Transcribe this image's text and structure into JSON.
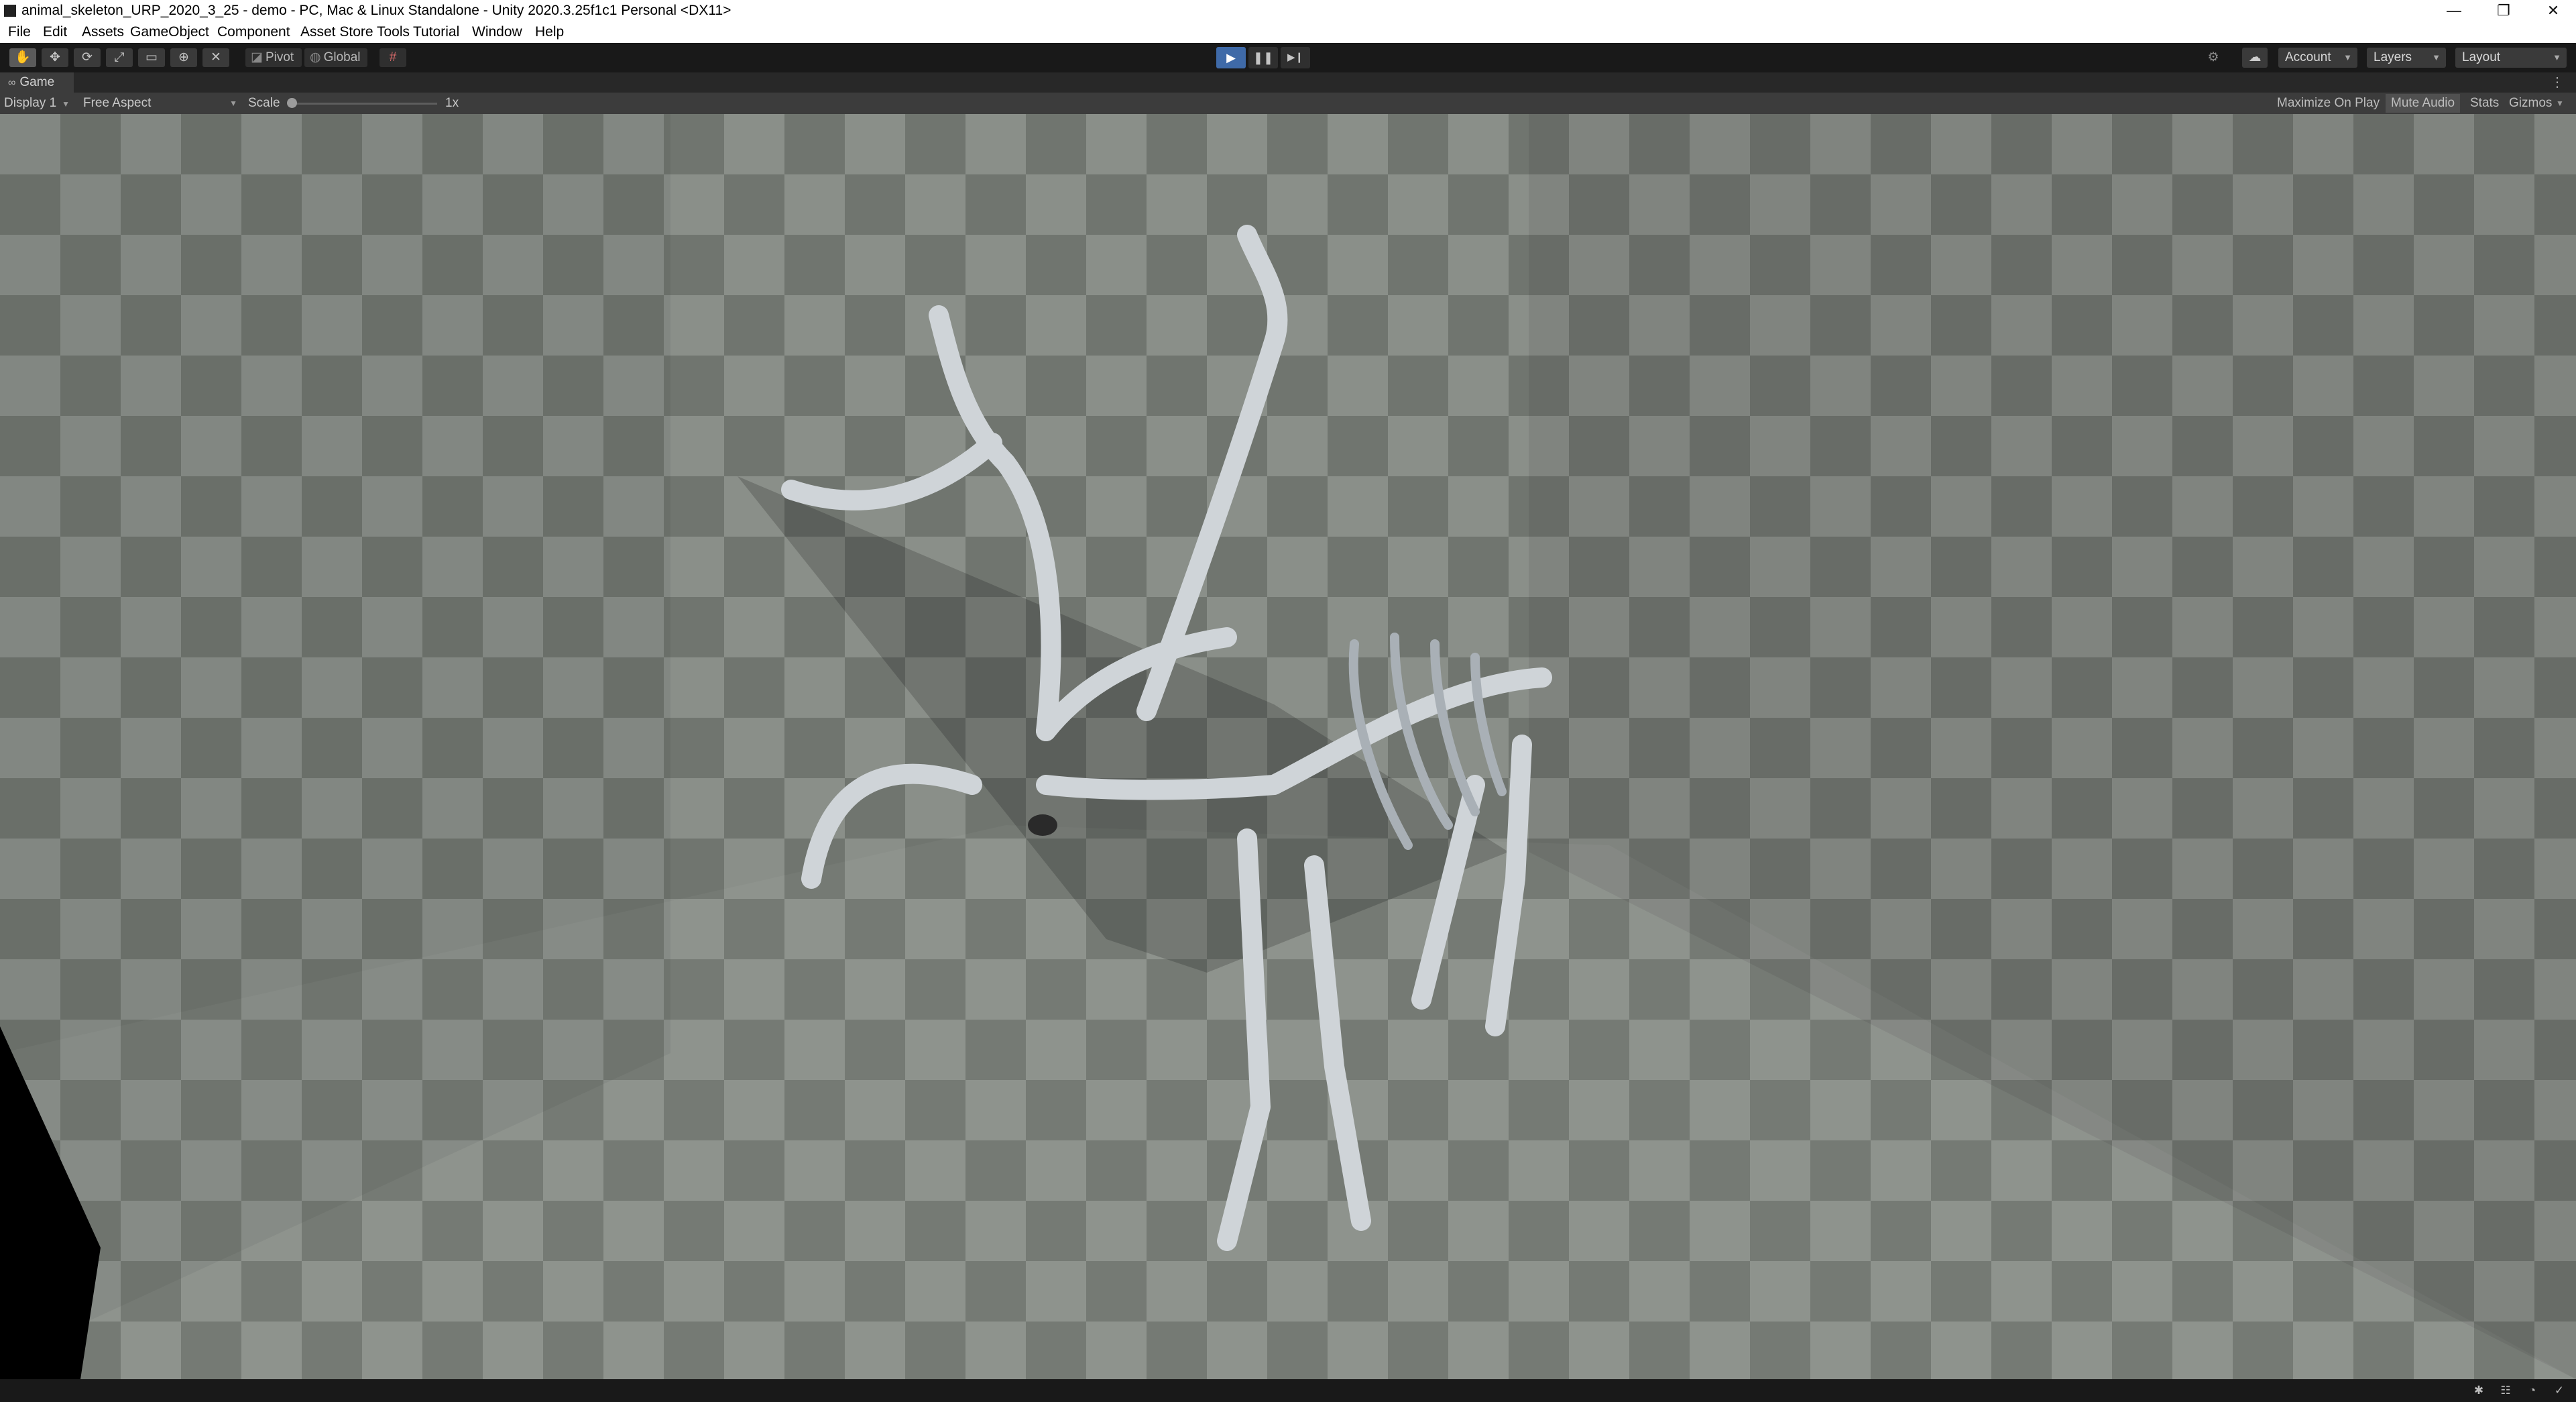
{
  "window": {
    "title": "animal_skeleton_URP_2020_3_25 - demo - PC, Mac & Linux Standalone - Unity 2020.3.25f1c1 Personal <DX11>",
    "minimize_glyph": "—",
    "maximize_glyph": "❐",
    "close_glyph": "✕"
  },
  "menu": {
    "items": [
      "File",
      "Edit",
      "Assets",
      "GameObject",
      "Component",
      "Asset Store Tools",
      "Tutorial",
      "Window",
      "Help"
    ]
  },
  "toolbar": {
    "tools": [
      {
        "icon": "hand-tool-icon",
        "glyph": "✋",
        "active": true
      },
      {
        "icon": "move-tool-icon",
        "glyph": "✥"
      },
      {
        "icon": "rotate-tool-icon",
        "glyph": "⟳"
      },
      {
        "icon": "scale-tool-icon",
        "glyph": "⤢"
      },
      {
        "icon": "rect-tool-icon",
        "glyph": "▭"
      },
      {
        "icon": "transform-tool-icon",
        "glyph": "⊕"
      },
      {
        "icon": "custom-tool-icon",
        "glyph": "✕"
      }
    ],
    "pivot_label": "Pivot",
    "global_label": "Global",
    "pivot_glyph": "◪",
    "global_glyph": "◍",
    "grid_snap_glyph": "#",
    "play_glyph": "▶",
    "pause_glyph": "❚❚",
    "step_glyph": "▶❙",
    "collab_glyph": "⚙",
    "cloud_glyph": "☁",
    "account_label": "Account",
    "layers_label": "Layers",
    "layout_label": "Layout",
    "caret_glyph": "▼"
  },
  "game_tab": {
    "glyph": "∞",
    "label": "Game",
    "kebab_glyph": "⋮"
  },
  "game_toolbar": {
    "display": "Display 1",
    "aspect": "Free Aspect",
    "scale_label": "Scale",
    "scale_value": 0.0,
    "scale_text": "1x",
    "maximize_on_play": "Maximize On Play",
    "mute_audio": "Mute Audio",
    "stats": "Stats",
    "gizmos": "Gizmos",
    "caret_glyph": "▼"
  },
  "status_bar": {
    "icons": [
      "bug-icon",
      "collab-status-icon",
      "progress-icon",
      "check-icon"
    ],
    "glyphs": [
      "✱",
      "☷",
      "◔",
      "✓"
    ]
  }
}
